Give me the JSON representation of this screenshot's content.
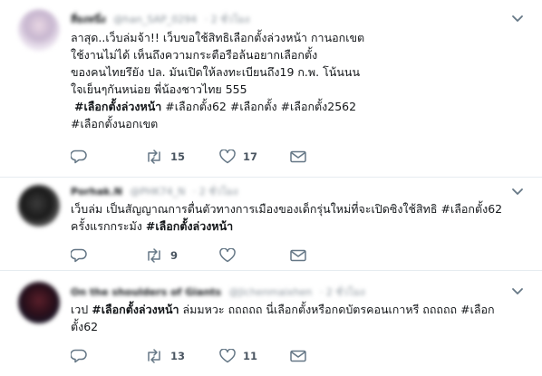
{
  "tweets": [
    {
      "name": "สี่ยงหนึ่ง",
      "handle": "@han_SAP_0294",
      "time": "· 2 ชั่วโมง",
      "lines": [
        "ลาสุด..เว็บล่มจ้า!! เว็บขอใช้สิทธิเลือกตั้งล่วงหน้า กานอกเขต",
        "ใช้งานไม่ได้ เห็นถึงความกระตือรือล้นอยากเลือกตั้ง",
        "ของคนไทยรึยัง ปล. มันเปิดให้ลงทะเบียนถึง19 ก.พ. โน้นนน",
        "ใจเย็นๆกันหน่อย พี่น้องชาวไทย 555"
      ],
      "hashtags_line1": [
        "#เลือกตั้งล่วงหน้า",
        "#เลือกตั้ง62",
        "#เลือกตั้ง",
        "#เลือกตั้ง2562"
      ],
      "hashtags_line2": [
        "#เลือกตั้งนอกเขต"
      ],
      "reply_count": "",
      "retweet_count": "15",
      "like_count": "17"
    },
    {
      "name": "Porhak.N",
      "handle": "@PHK74_N",
      "time": "· 2 ชั่วโมง",
      "line1": "เว็บล่ม เป็นสัญญาณการตื่นตัวทางการเมืองของเด็กรุ่นใหม่ที่จะเปิดซิงใช้สิทธิ #เลือกตั้ง62",
      "line2_text": "ครั้งแรกกระมัง",
      "line2_tag": "#เลือกตั้งล่วงหน้า",
      "reply_count": "",
      "retweet_count": "9",
      "like_count": ""
    },
    {
      "name": "On the shoulders of Giants",
      "handle": "@Jichenmaixhen",
      "time": "· 2 ชั่วโมง",
      "line1_prefix": "เวป",
      "line1_tag": "#เลือกตั้งล่วงหน้า",
      "line1_rest": "ล่มมหวะ ถถถถถ นี่เลือกตั้งหรือกดบัตรคอนเกาหรี ถถถถถ #เลือก",
      "line2": "ตั้ง62",
      "reply_count": "",
      "retweet_count": "13",
      "like_count": "11"
    }
  ],
  "icons": {
    "reply": "reply-icon",
    "retweet": "retweet-icon",
    "like": "heart-icon",
    "message": "envelope-icon",
    "more": "chevron-down-icon"
  },
  "colors": {
    "icon": "#657786",
    "divider": "#e6ecf0",
    "text": "#14171a"
  }
}
